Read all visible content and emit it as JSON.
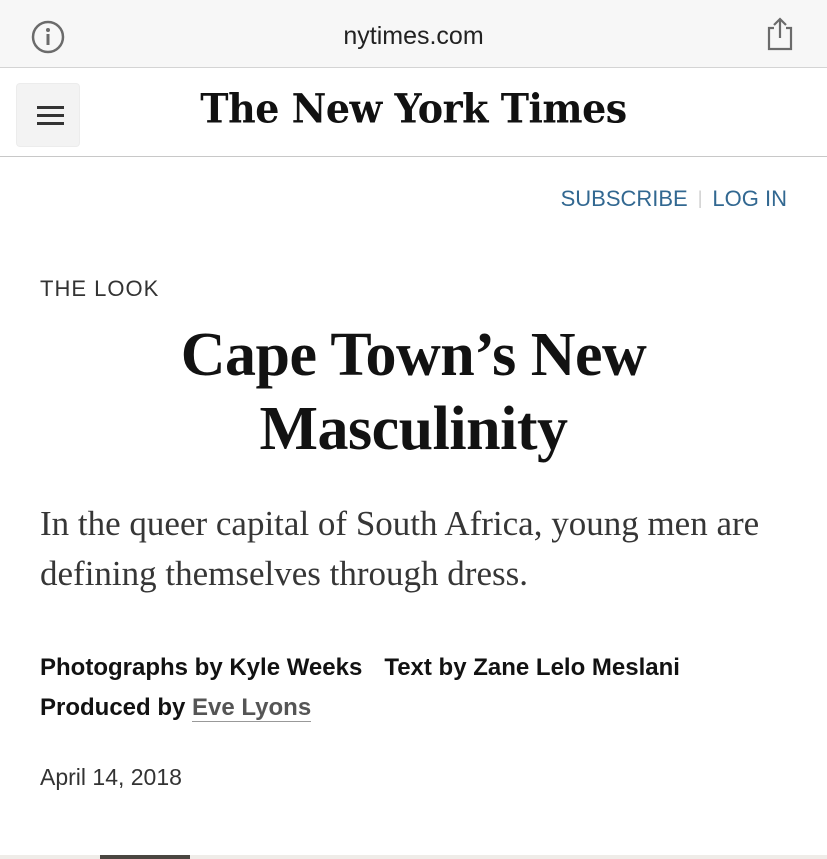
{
  "browser": {
    "url": "nytimes.com",
    "info_icon": "info-circle-icon",
    "share_icon": "share-icon"
  },
  "header": {
    "menu_icon": "hamburger-menu-icon",
    "logo_text": "The New York Times"
  },
  "account": {
    "subscribe_label": "SUBSCRIBE",
    "login_label": "LOG IN",
    "separator": "|"
  },
  "article": {
    "kicker": "THE LOOK",
    "headline_line1": "Cape Town’s New",
    "headline_line2": "Masculinity",
    "summary": "In the queer capital of South Africa, young men are defining themselves through dress.",
    "photographs_by": "Photographs by Kyle Weeks",
    "text_by": "Text by Zane Lelo Meslani",
    "produced_by_prefix": "Produced by ",
    "producer_name": "Eve Lyons",
    "date": "April 14, 2018"
  },
  "colors": {
    "link_blue": "#326891",
    "text": "#121212",
    "urlbar_bg": "#f7f7f7"
  }
}
